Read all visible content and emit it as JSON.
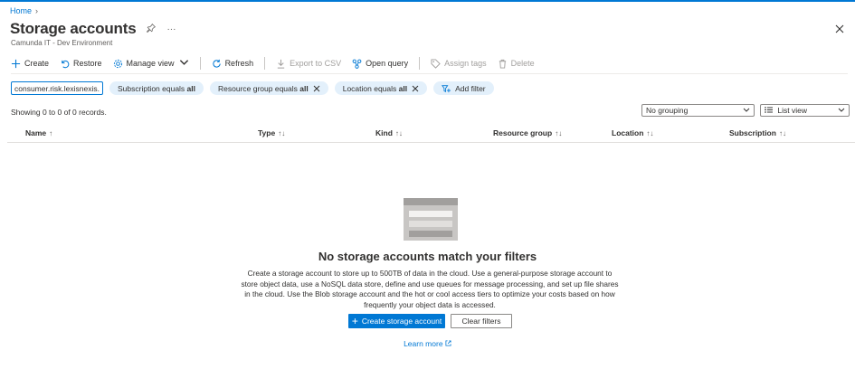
{
  "breadcrumb": {
    "home": "Home",
    "separator": "›"
  },
  "header": {
    "title": "Storage accounts",
    "pin_icon": "pin-icon",
    "more_icon": "more-icon",
    "more_glyph": "···",
    "subtitle": "Camunda IT - Dev Environment",
    "close_icon": "close-icon"
  },
  "toolbar": {
    "create": "Create",
    "restore": "Restore",
    "manage_view": "Manage view",
    "refresh": "Refresh",
    "export_csv": "Export to CSV",
    "open_query": "Open query",
    "assign_tags": "Assign tags",
    "delete": "Delete"
  },
  "filters": {
    "search_value": "consumer.risk.lexisnexis.com",
    "pills": [
      {
        "label": "Subscription equals ",
        "value": "all"
      },
      {
        "label": "Resource group equals ",
        "value": "all"
      },
      {
        "label": "Location equals ",
        "value": "all"
      }
    ],
    "add_filter": "Add filter"
  },
  "records": "Showing 0 to 0 of 0 records.",
  "grouping": {
    "selected": "No grouping"
  },
  "view": {
    "selected": "List view"
  },
  "table": {
    "columns": [
      "Name",
      "Type",
      "Kind",
      "Resource group",
      "Location",
      "Subscription"
    ],
    "sort_glyph_name": "↑",
    "sort_glyph": "↑↓"
  },
  "empty_state": {
    "title": "No storage accounts match your filters",
    "description": "Create a storage account to store up to 500TB of data in the cloud. Use a general-purpose storage account to store object data, use a NoSQL data store, define and use queues for message processing, and set up file shares in the cloud. Use the Blob storage account and the hot or cool access tiers to optimize your costs based on how frequently your object data is accessed.",
    "create_button": "Create storage account",
    "clear_button": "Clear filters",
    "learn_more": "Learn more"
  },
  "colors": {
    "accent": "#0078d4",
    "pill_bg": "#e3f0fb",
    "text": "#323130"
  }
}
